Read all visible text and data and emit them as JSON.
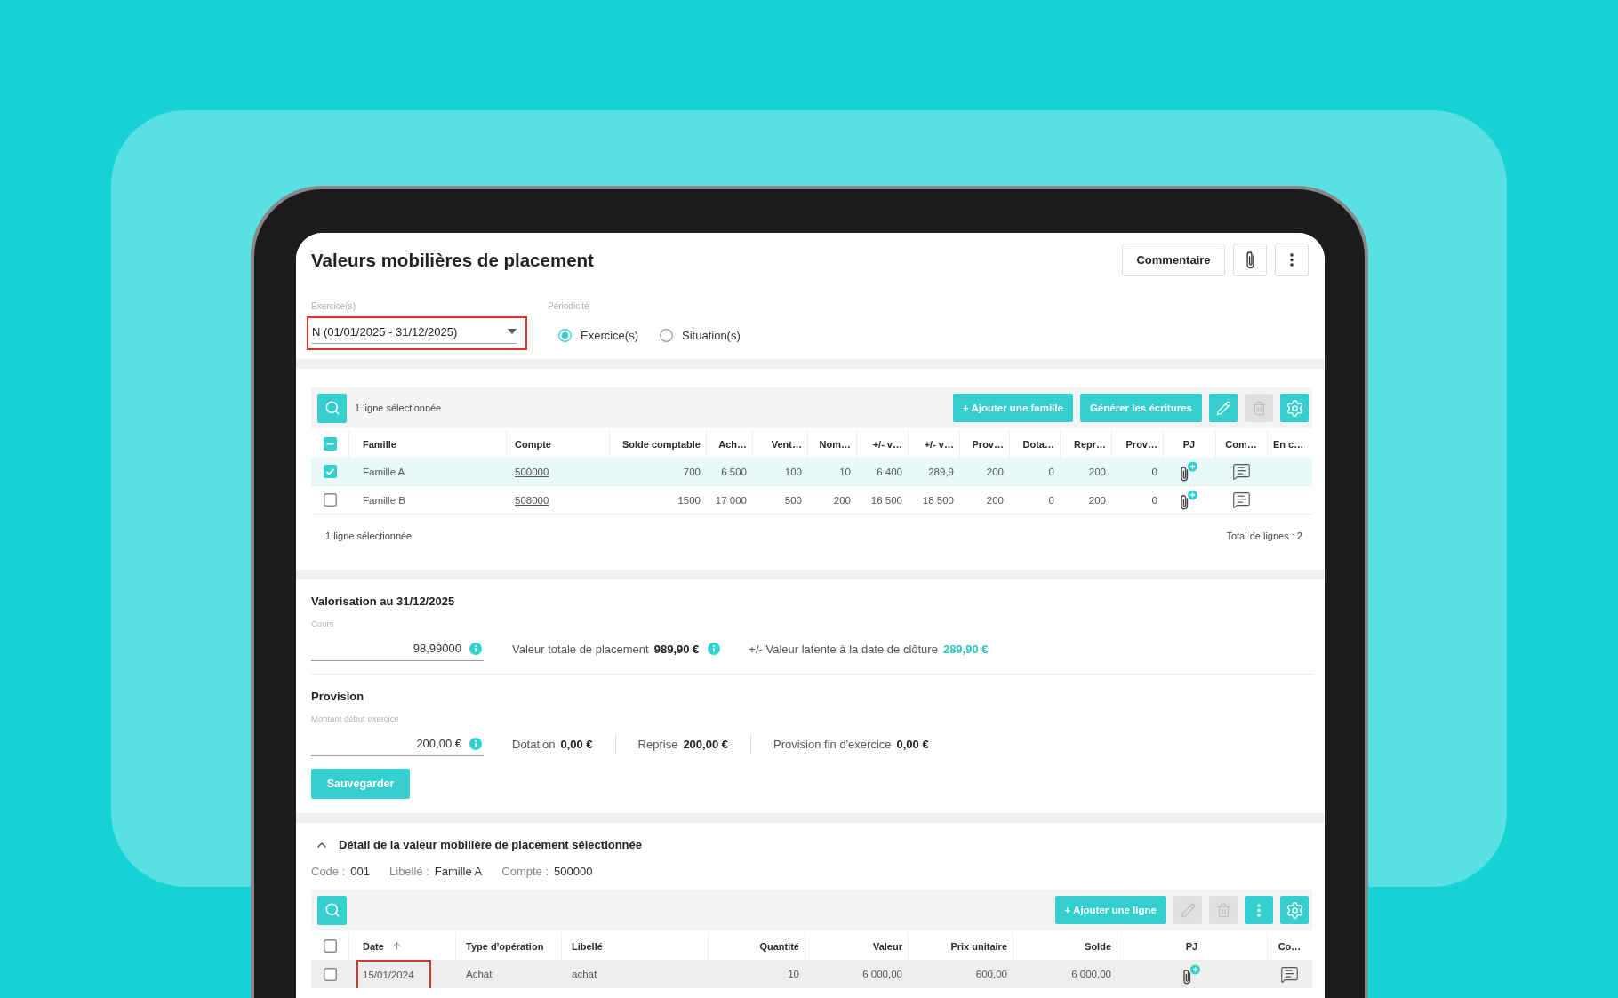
{
  "header": {
    "title": "Valeurs mobilières de placement",
    "actions": [
      {
        "kind": "text",
        "label": "Commentaire"
      },
      {
        "kind": "attach"
      },
      {
        "kind": "more"
      }
    ]
  },
  "filters": {
    "exercise": {
      "label": "Exercice(s)",
      "value": "N (01/01/2025 - 31/12/2025)",
      "annotated": true
    },
    "periodicity": {
      "label": "Périodicité",
      "options": [
        {
          "label": "Exercice(s)",
          "selected": true
        },
        {
          "label": "Situation(s)",
          "selected": false
        }
      ]
    }
  },
  "families_table": {
    "selection_text": "1 ligne sélectionnée",
    "buttons": [
      {
        "kind": "text",
        "label": "+ Ajouter une famille",
        "disabled": false
      },
      {
        "kind": "text",
        "label": "Générer les écritures",
        "disabled": false
      },
      {
        "kind": "edit",
        "disabled": false
      },
      {
        "kind": "delete",
        "disabled": true
      },
      {
        "kind": "settings",
        "disabled": false
      }
    ],
    "select_all": {
      "checked": false,
      "indeterminate": true
    },
    "columns": [
      {
        "label": "Famille",
        "kind": "name"
      },
      {
        "label": "Compte",
        "kind": "account"
      },
      {
        "label": "Solde comptable",
        "kind": "amount"
      },
      {
        "label": "Ach…",
        "kind": "amount"
      },
      {
        "label": "Vent…",
        "kind": "amount"
      },
      {
        "label": "Nom…",
        "kind": "amount"
      },
      {
        "label": "+/- v…",
        "kind": "amount"
      },
      {
        "label": "+/- v…",
        "kind": "amount"
      },
      {
        "label": "Prov…",
        "kind": "amount"
      },
      {
        "label": "Dota…",
        "kind": "amount"
      },
      {
        "label": "Repr…",
        "kind": "amount"
      },
      {
        "label": "Prov…",
        "kind": "amount"
      },
      {
        "label": "PJ",
        "kind": "attachment"
      },
      {
        "label": "Com…",
        "kind": "comment"
      },
      {
        "label": "En c…",
        "kind": "other"
      }
    ],
    "rows": [
      {
        "selected": true,
        "cells": [
          "Famille A",
          "500000",
          "700",
          "6 500",
          "100",
          "10",
          "6 400",
          "289,9",
          "200",
          "0",
          "200",
          "0"
        ]
      },
      {
        "selected": false,
        "cells": [
          "Famille B",
          "508000",
          "1500",
          "17 000",
          "500",
          "200",
          "16 500",
          "18 500",
          "200",
          "0",
          "200",
          "0"
        ]
      }
    ],
    "footer_left": "1 ligne sélectionnée",
    "footer_right": "Total de lignes : 2"
  },
  "valuation": {
    "title": "Valorisation au 31/12/2025",
    "price": {
      "label": "Cours",
      "value": "98,99000"
    },
    "figures": [
      {
        "label": "Valeur totale de placement",
        "value": "989,90 €",
        "info": true,
        "accent": false
      },
      {
        "label": "+/- Valeur latente à la date de clôture",
        "value": "289,90 €",
        "info": false,
        "accent": true
      }
    ]
  },
  "provision": {
    "title": "Provision",
    "opening": {
      "label": "Montant début exercice",
      "value": "200,00 €"
    },
    "figures": [
      {
        "label": "Dotation",
        "value": "0,00 €"
      },
      {
        "label": "Reprise",
        "value": "200,00 €"
      },
      {
        "label": "Provision fin d'exercice",
        "value": "0,00 €"
      }
    ],
    "save_label": "Sauvegarder"
  },
  "detail": {
    "title": "Détail de la valeur mobilière de placement sélectionnée",
    "expanded": true,
    "meta": [
      {
        "label": "Code :",
        "value": "001"
      },
      {
        "label": "Libellé :",
        "value": "Famille A"
      },
      {
        "label": "Compte :",
        "value": "500000"
      }
    ],
    "buttons": [
      {
        "kind": "text",
        "label": "+ Ajouter une ligne",
        "disabled": false
      },
      {
        "kind": "edit",
        "disabled": true
      },
      {
        "kind": "delete",
        "disabled": true
      },
      {
        "kind": "more",
        "disabled": false
      },
      {
        "kind": "settings",
        "disabled": false
      }
    ],
    "select_all": {
      "checked": false,
      "indeterminate": false
    },
    "columns": [
      {
        "label": "Date",
        "kind": "date",
        "sorted": true
      },
      {
        "label": "Type d'opération",
        "kind": "text",
        "sorted": false
      },
      {
        "label": "Libellé",
        "kind": "text",
        "sorted": false
      },
      {
        "label": "Quantité",
        "kind": "amount",
        "sorted": false
      },
      {
        "label": "Valeur",
        "kind": "amount",
        "sorted": false
      },
      {
        "label": "Prix unitaire",
        "kind": "amount",
        "sorted": false
      },
      {
        "label": "Solde",
        "kind": "amount",
        "sorted": false
      },
      {
        "label": "PJ",
        "kind": "attachment",
        "sorted": false
      },
      {
        "label": "Co…",
        "kind": "comment",
        "sorted": false
      }
    ],
    "rows": [
      {
        "checked": false,
        "hovered": true,
        "date_annotated": true,
        "cells": [
          "15/01/2024",
          "Achat",
          "achat",
          "10",
          "6 000,00",
          "600,00",
          "6 000,00"
        ]
      }
    ]
  }
}
